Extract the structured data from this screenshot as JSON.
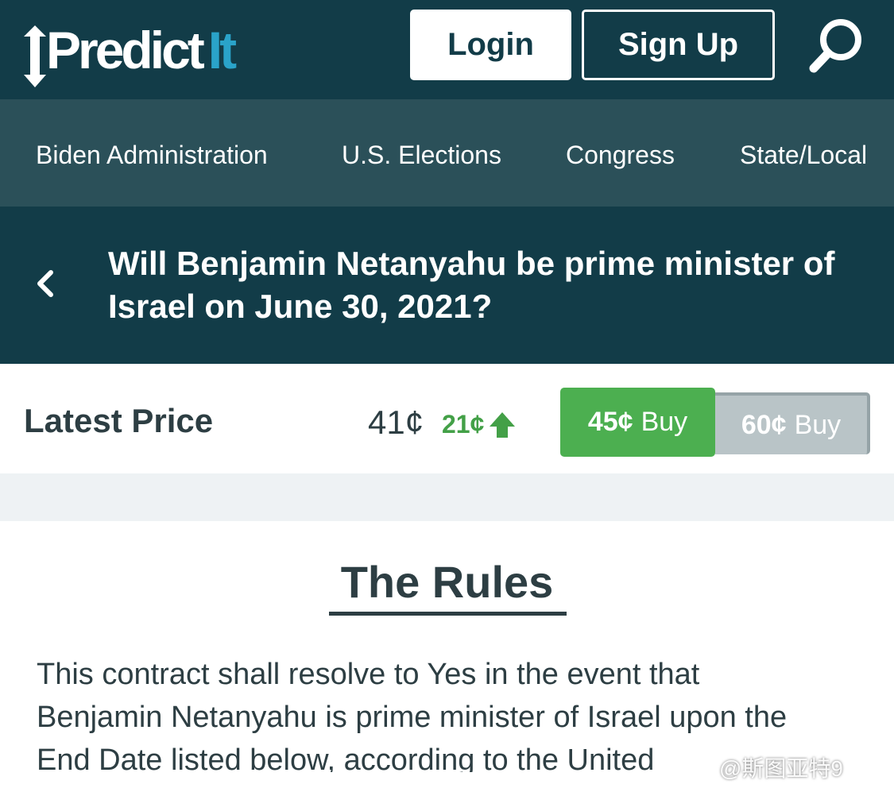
{
  "header": {
    "logo_main": "Predict",
    "logo_accent": "It",
    "login_label": "Login",
    "signup_label": "Sign Up"
  },
  "nav": {
    "items": [
      {
        "label": "Biden Administration"
      },
      {
        "label": "U.S. Elections"
      },
      {
        "label": "Congress"
      },
      {
        "label": "State/Local"
      }
    ]
  },
  "market": {
    "title": "Will Benjamin Netanyahu be prime minister of Israel on June 30, 2021?"
  },
  "price": {
    "label": "Latest Price",
    "last": "41¢",
    "change": "21¢",
    "change_direction": "up",
    "yes_price": "45¢",
    "yes_action": "Buy",
    "no_price": "60¢",
    "no_action": "Buy"
  },
  "rules": {
    "heading": "The Rules",
    "text": "This contract shall resolve to Yes in the event that Benjamin Netanyahu is prime minister of Israel upon the End Date listed below, according to the United"
  },
  "watermark": "@斯图亚特9",
  "colors": {
    "header_bg": "#123c48",
    "nav_bg": "#2b5059",
    "accent": "#2aa3c9",
    "green": "#4caf50",
    "gray_button": "#b9c4c7",
    "text_dark": "#2d3e43"
  }
}
